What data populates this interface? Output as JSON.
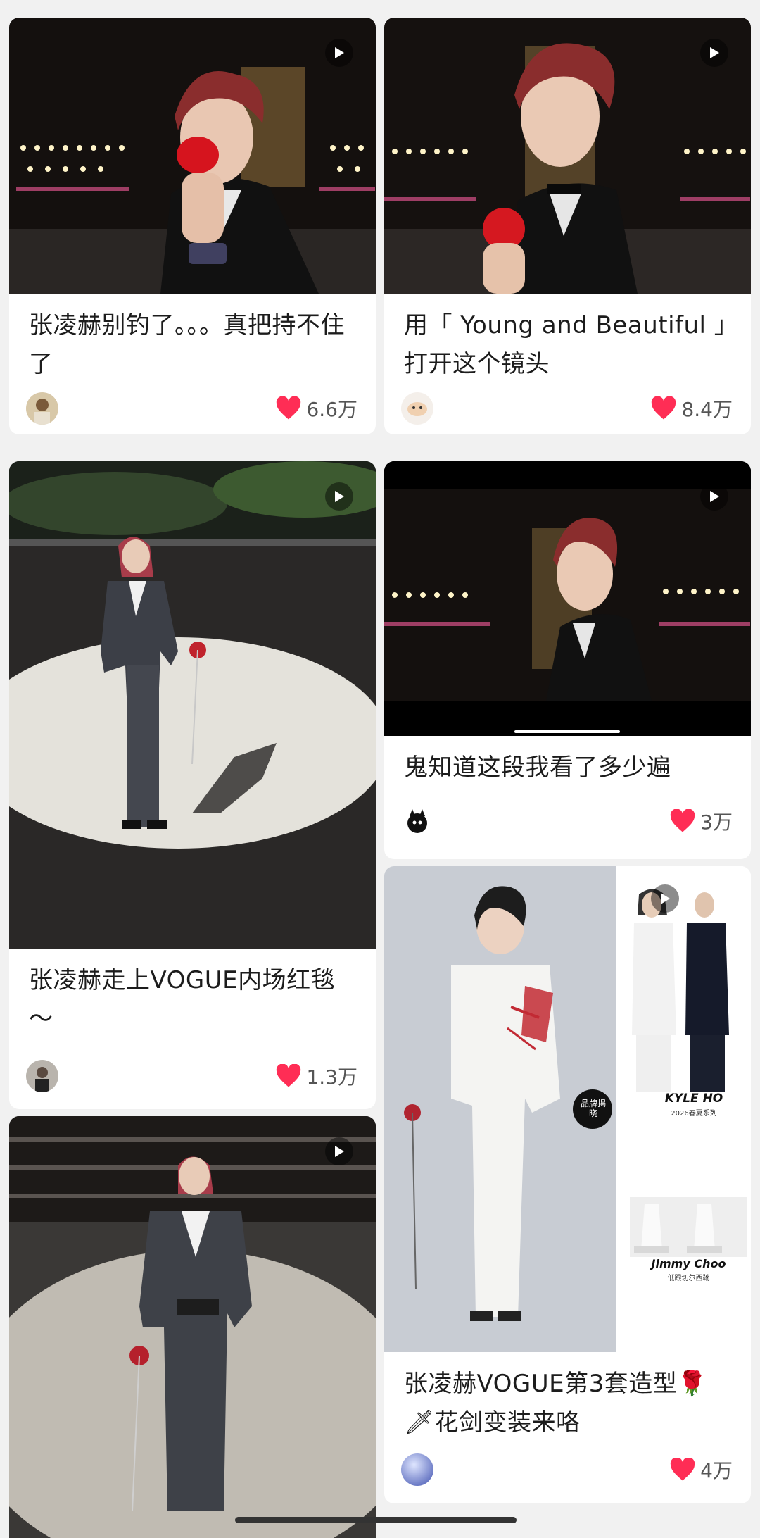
{
  "feed": {
    "cards": [
      {
        "title": "张凌赫别钓了。。。真把持不住了",
        "likes": "6.6万"
      },
      {
        "title": "用「 Young and Beautiful 」打开这个镜头",
        "likes": "8.4万"
      },
      {
        "title": "张凌赫走上VOGUE内场红毯～",
        "likes": "1.3万"
      },
      {
        "title": "鬼知道这段我看了多少遍",
        "likes": "3万"
      },
      {
        "title": "张凌赫VOGUE第3套造型🌹🗡花剑变装来咯",
        "likes": "4万",
        "overlay": {
          "kyle_brand": "KYLE HO",
          "kyle_sub": "2026春夏系列",
          "jimmy_brand": "Jimmy Choo",
          "jimmy_sub": "低跟切尔西靴",
          "badge": "品牌揭晓"
        }
      },
      {
        "title": "",
        "likes": ""
      }
    ]
  },
  "colors": {
    "like_heart": "#ff2d55",
    "page_bg": "#f1f1f1",
    "card_bg": "#ffffff"
  },
  "icons": {
    "play": "play-icon",
    "heart": "heart-icon"
  }
}
